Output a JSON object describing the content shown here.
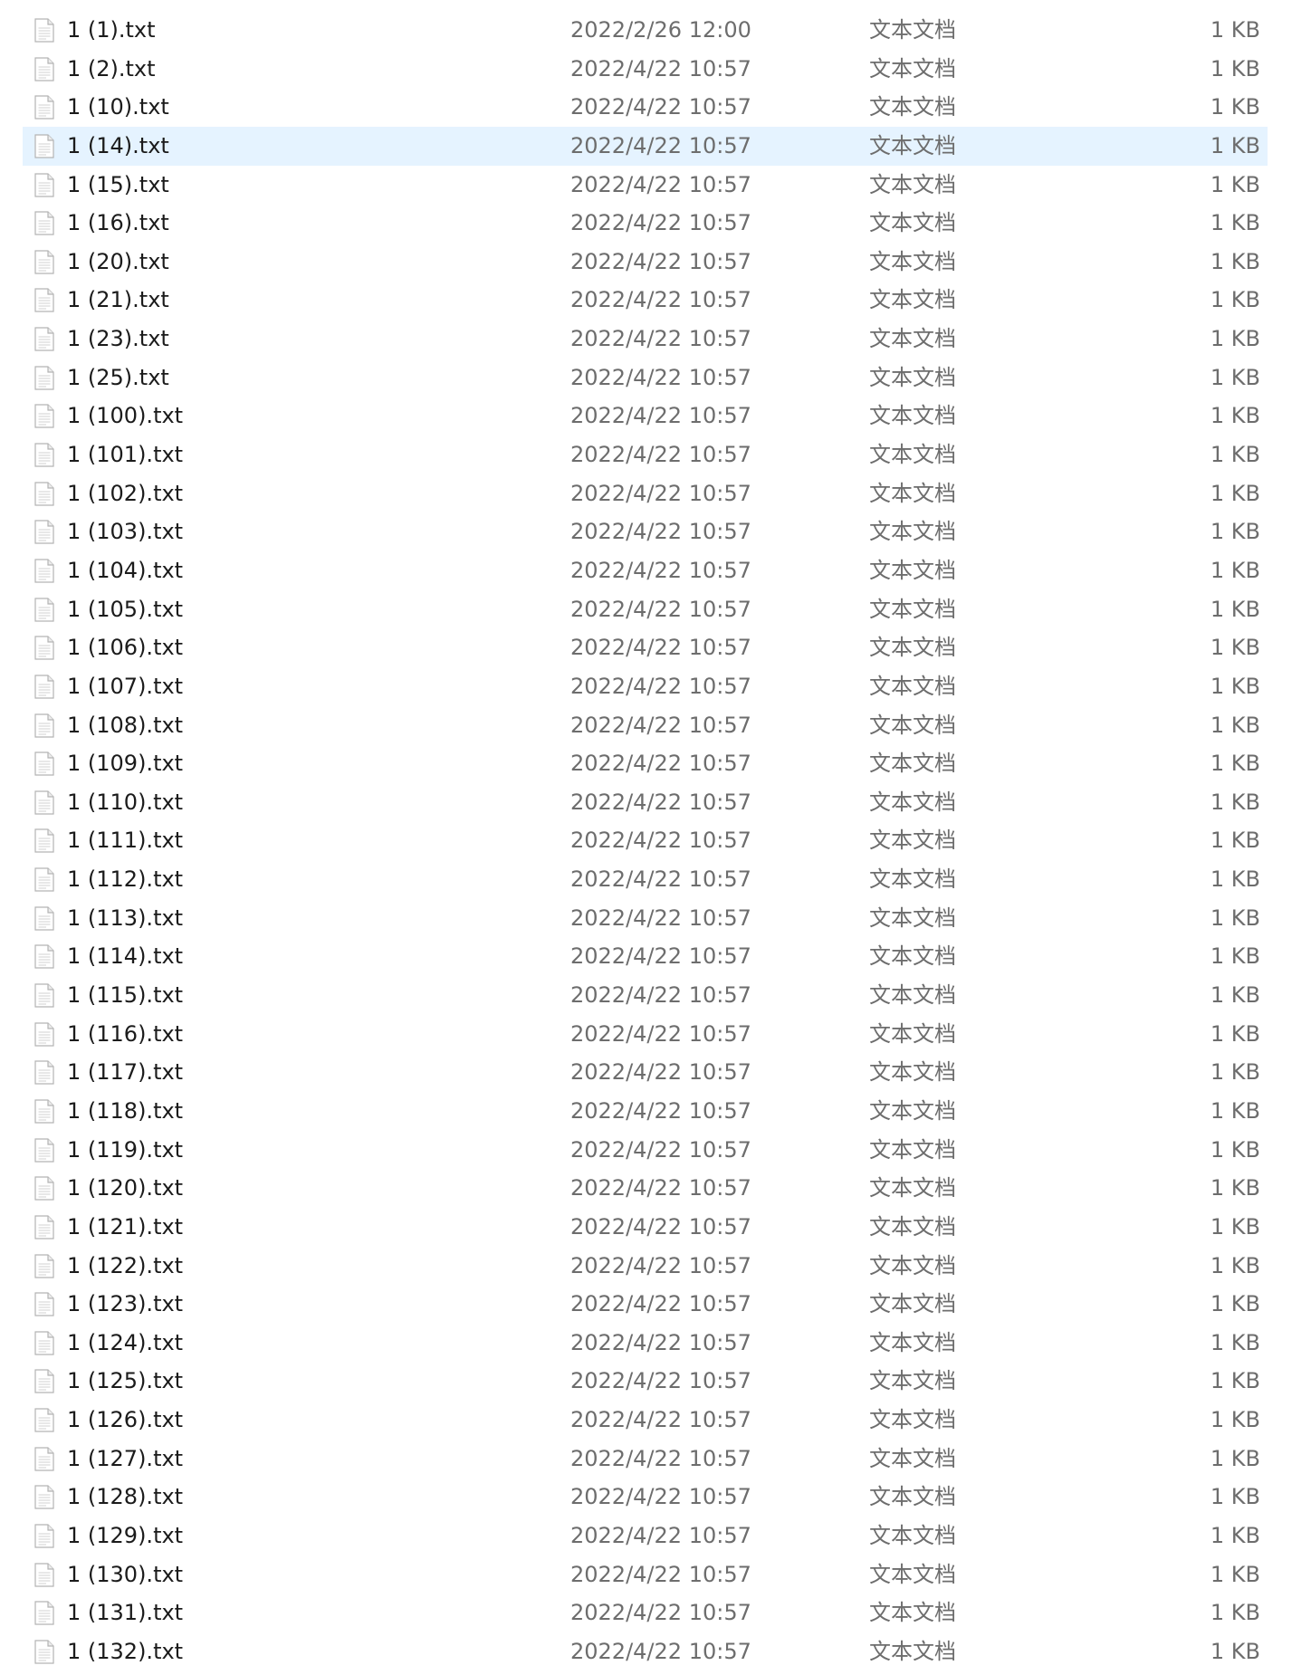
{
  "icons": {
    "file": "text-file-icon"
  },
  "colors": {
    "selection_background": "#e5f3ff",
    "name_text": "#1b1b1b",
    "detail_text": "#6d6d6d"
  },
  "files": [
    {
      "name": "1 (1).txt",
      "date": "2022/2/26 12:00",
      "type": "文本文档",
      "size": "1 KB"
    },
    {
      "name": "1 (2).txt",
      "date": "2022/4/22 10:57",
      "type": "文本文档",
      "size": "1 KB"
    },
    {
      "name": "1 (10).txt",
      "date": "2022/4/22 10:57",
      "type": "文本文档",
      "size": "1 KB"
    },
    {
      "name": "1 (14).txt",
      "date": "2022/4/22 10:57",
      "type": "文本文档",
      "size": "1 KB",
      "selected": true
    },
    {
      "name": "1 (15).txt",
      "date": "2022/4/22 10:57",
      "type": "文本文档",
      "size": "1 KB"
    },
    {
      "name": "1 (16).txt",
      "date": "2022/4/22 10:57",
      "type": "文本文档",
      "size": "1 KB"
    },
    {
      "name": "1 (20).txt",
      "date": "2022/4/22 10:57",
      "type": "文本文档",
      "size": "1 KB"
    },
    {
      "name": "1 (21).txt",
      "date": "2022/4/22 10:57",
      "type": "文本文档",
      "size": "1 KB"
    },
    {
      "name": "1 (23).txt",
      "date": "2022/4/22 10:57",
      "type": "文本文档",
      "size": "1 KB"
    },
    {
      "name": "1 (25).txt",
      "date": "2022/4/22 10:57",
      "type": "文本文档",
      "size": "1 KB"
    },
    {
      "name": "1 (100).txt",
      "date": "2022/4/22 10:57",
      "type": "文本文档",
      "size": "1 KB"
    },
    {
      "name": "1 (101).txt",
      "date": "2022/4/22 10:57",
      "type": "文本文档",
      "size": "1 KB"
    },
    {
      "name": "1 (102).txt",
      "date": "2022/4/22 10:57",
      "type": "文本文档",
      "size": "1 KB"
    },
    {
      "name": "1 (103).txt",
      "date": "2022/4/22 10:57",
      "type": "文本文档",
      "size": "1 KB"
    },
    {
      "name": "1 (104).txt",
      "date": "2022/4/22 10:57",
      "type": "文本文档",
      "size": "1 KB"
    },
    {
      "name": "1 (105).txt",
      "date": "2022/4/22 10:57",
      "type": "文本文档",
      "size": "1 KB"
    },
    {
      "name": "1 (106).txt",
      "date": "2022/4/22 10:57",
      "type": "文本文档",
      "size": "1 KB"
    },
    {
      "name": "1 (107).txt",
      "date": "2022/4/22 10:57",
      "type": "文本文档",
      "size": "1 KB"
    },
    {
      "name": "1 (108).txt",
      "date": "2022/4/22 10:57",
      "type": "文本文档",
      "size": "1 KB"
    },
    {
      "name": "1 (109).txt",
      "date": "2022/4/22 10:57",
      "type": "文本文档",
      "size": "1 KB"
    },
    {
      "name": "1 (110).txt",
      "date": "2022/4/22 10:57",
      "type": "文本文档",
      "size": "1 KB"
    },
    {
      "name": "1 (111).txt",
      "date": "2022/4/22 10:57",
      "type": "文本文档",
      "size": "1 KB"
    },
    {
      "name": "1 (112).txt",
      "date": "2022/4/22 10:57",
      "type": "文本文档",
      "size": "1 KB"
    },
    {
      "name": "1 (113).txt",
      "date": "2022/4/22 10:57",
      "type": "文本文档",
      "size": "1 KB"
    },
    {
      "name": "1 (114).txt",
      "date": "2022/4/22 10:57",
      "type": "文本文档",
      "size": "1 KB"
    },
    {
      "name": "1 (115).txt",
      "date": "2022/4/22 10:57",
      "type": "文本文档",
      "size": "1 KB"
    },
    {
      "name": "1 (116).txt",
      "date": "2022/4/22 10:57",
      "type": "文本文档",
      "size": "1 KB"
    },
    {
      "name": "1 (117).txt",
      "date": "2022/4/22 10:57",
      "type": "文本文档",
      "size": "1 KB"
    },
    {
      "name": "1 (118).txt",
      "date": "2022/4/22 10:57",
      "type": "文本文档",
      "size": "1 KB"
    },
    {
      "name": "1 (119).txt",
      "date": "2022/4/22 10:57",
      "type": "文本文档",
      "size": "1 KB"
    },
    {
      "name": "1 (120).txt",
      "date": "2022/4/22 10:57",
      "type": "文本文档",
      "size": "1 KB"
    },
    {
      "name": "1 (121).txt",
      "date": "2022/4/22 10:57",
      "type": "文本文档",
      "size": "1 KB"
    },
    {
      "name": "1 (122).txt",
      "date": "2022/4/22 10:57",
      "type": "文本文档",
      "size": "1 KB"
    },
    {
      "name": "1 (123).txt",
      "date": "2022/4/22 10:57",
      "type": "文本文档",
      "size": "1 KB"
    },
    {
      "name": "1 (124).txt",
      "date": "2022/4/22 10:57",
      "type": "文本文档",
      "size": "1 KB"
    },
    {
      "name": "1 (125).txt",
      "date": "2022/4/22 10:57",
      "type": "文本文档",
      "size": "1 KB"
    },
    {
      "name": "1 (126).txt",
      "date": "2022/4/22 10:57",
      "type": "文本文档",
      "size": "1 KB"
    },
    {
      "name": "1 (127).txt",
      "date": "2022/4/22 10:57",
      "type": "文本文档",
      "size": "1 KB"
    },
    {
      "name": "1 (128).txt",
      "date": "2022/4/22 10:57",
      "type": "文本文档",
      "size": "1 KB"
    },
    {
      "name": "1 (129).txt",
      "date": "2022/4/22 10:57",
      "type": "文本文档",
      "size": "1 KB"
    },
    {
      "name": "1 (130).txt",
      "date": "2022/4/22 10:57",
      "type": "文本文档",
      "size": "1 KB"
    },
    {
      "name": "1 (131).txt",
      "date": "2022/4/22 10:57",
      "type": "文本文档",
      "size": "1 KB"
    },
    {
      "name": "1 (132).txt",
      "date": "2022/4/22 10:57",
      "type": "文本文档",
      "size": "1 KB"
    }
  ]
}
